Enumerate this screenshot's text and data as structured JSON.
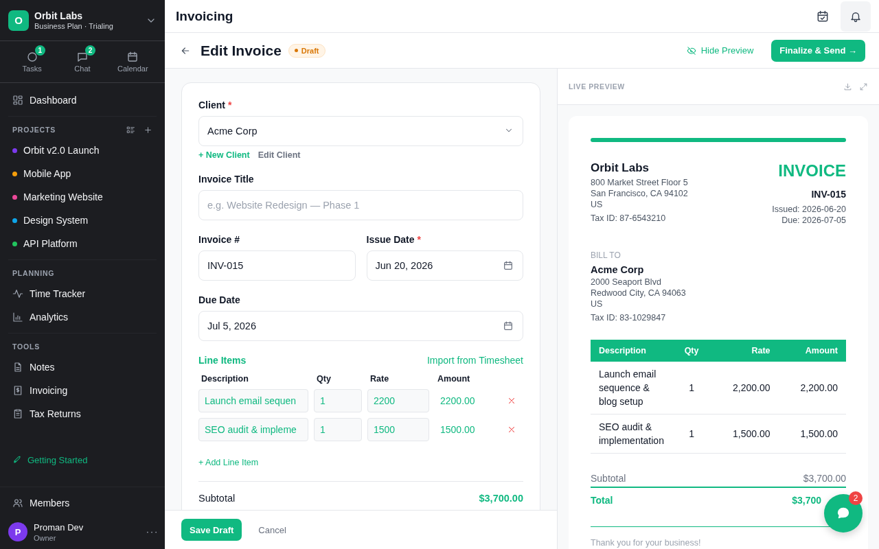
{
  "sidebar": {
    "workspace": {
      "initial": "O",
      "name": "Orbit Labs",
      "plan": "Business Plan · Trialing"
    },
    "quick_links": [
      {
        "kind": "tasks",
        "label": "Tasks",
        "badge": "1"
      },
      {
        "kind": "chat",
        "label": "Chat",
        "badge": "2"
      },
      {
        "kind": "calendar",
        "label": "Calendar"
      }
    ],
    "sections": [
      {
        "items": [
          {
            "kind": "grid",
            "label": "Dashboard"
          }
        ]
      },
      {
        "title": "PROJECTS",
        "projects": [
          {
            "label": "Orbit v2.0 Launch",
            "color": "#7c3aed"
          },
          {
            "label": "Mobile App",
            "color": "#f59e0b"
          },
          {
            "label": "Marketing Website",
            "color": "#ec4899"
          },
          {
            "label": "Design System",
            "color": "#0ea5e9"
          },
          {
            "label": "API Platform",
            "color": "#22c55e"
          }
        ]
      },
      {
        "title": "PLANNING",
        "items": [
          {
            "kind": "pulse",
            "label": "Time Tracker"
          },
          {
            "kind": "chart",
            "label": "Analytics"
          }
        ]
      },
      {
        "title": "TOOLS",
        "items": [
          {
            "kind": "doc",
            "label": "Notes"
          },
          {
            "kind": "receipt",
            "label": "Invoicing"
          },
          {
            "kind": "clipboard",
            "label": "Tax Returns"
          }
        ]
      }
    ],
    "getting_started": "Getting Started",
    "members": "Members",
    "user": {
      "initial": "P",
      "name": "Proman Dev",
      "role": "Owner"
    }
  },
  "header": {
    "title": "Invoicing"
  },
  "page": {
    "title": "Edit Invoice",
    "status": "Draft",
    "hide_preview": "Hide Preview",
    "finalize": "Finalize & Send →"
  },
  "form": {
    "client": {
      "label": "Client",
      "required_mark": "*",
      "value": "Acme Corp"
    },
    "client_links": {
      "new": "+ New Client",
      "edit": "Edit Client"
    },
    "invoice_title": {
      "label": "Invoice Title",
      "placeholder": "e.g. Website Redesign — Phase 1"
    },
    "invoice_number": {
      "label": "Invoice #",
      "value": "INV-015"
    },
    "issue_date": {
      "label": "Issue Date",
      "required_mark": "*",
      "value": "Jun 20, 2026"
    },
    "due_date": {
      "label": "Due Date",
      "value": "Jul 5, 2026"
    },
    "line_items": {
      "title": "Line Items",
      "import": "Import from Timesheet",
      "columns": [
        "Description",
        "Qty",
        "Rate",
        "Amount"
      ],
      "rows": [
        {
          "description": "Launch email sequen",
          "qty": "1",
          "rate": "2200",
          "amount": "2200.00"
        },
        {
          "description": "SEO audit & impleme",
          "qty": "1",
          "rate": "1500",
          "amount": "1500.00"
        }
      ],
      "add": "+ Add Line Item"
    },
    "subtotal": {
      "label": "Subtotal",
      "value": "$3,700.00"
    }
  },
  "footer": {
    "save": "Save Draft",
    "cancel": "Cancel"
  },
  "preview": {
    "label": "LIVE PREVIEW",
    "company": {
      "name": "Orbit Labs",
      "lines": [
        "800 Market Street Floor 5",
        "San Francisco, CA 94102",
        "US"
      ],
      "tax_id": "Tax ID: 87-6543210"
    },
    "heading": "INVOICE",
    "number": "INV-015",
    "issued": "Issued: 2026-06-20",
    "due": "Due: 2026-07-05",
    "bill_to": {
      "label": "BILL TO",
      "name": "Acme Corp",
      "lines": [
        "2000 Seaport Blvd",
        "Redwood City, CA 94063",
        "US"
      ],
      "tax_id": "Tax ID: 83-1029847"
    },
    "table": {
      "columns": [
        "Description",
        "Qty",
        "Rate",
        "Amount"
      ],
      "rows": [
        {
          "description": "Launch email sequence & blog setup",
          "qty": "1",
          "rate": "2,200.00",
          "amount": "2,200.00"
        },
        {
          "description": "SEO audit & implementation",
          "qty": "1",
          "rate": "1,500.00",
          "amount": "1,500.00"
        }
      ]
    },
    "subtotal": {
      "label": "Subtotal",
      "value": "$3,700.00"
    },
    "total": {
      "label": "Total",
      "value": "$3,700"
    },
    "thanks": "Thank you for your business!"
  },
  "chat_fab": {
    "badge": "2"
  }
}
